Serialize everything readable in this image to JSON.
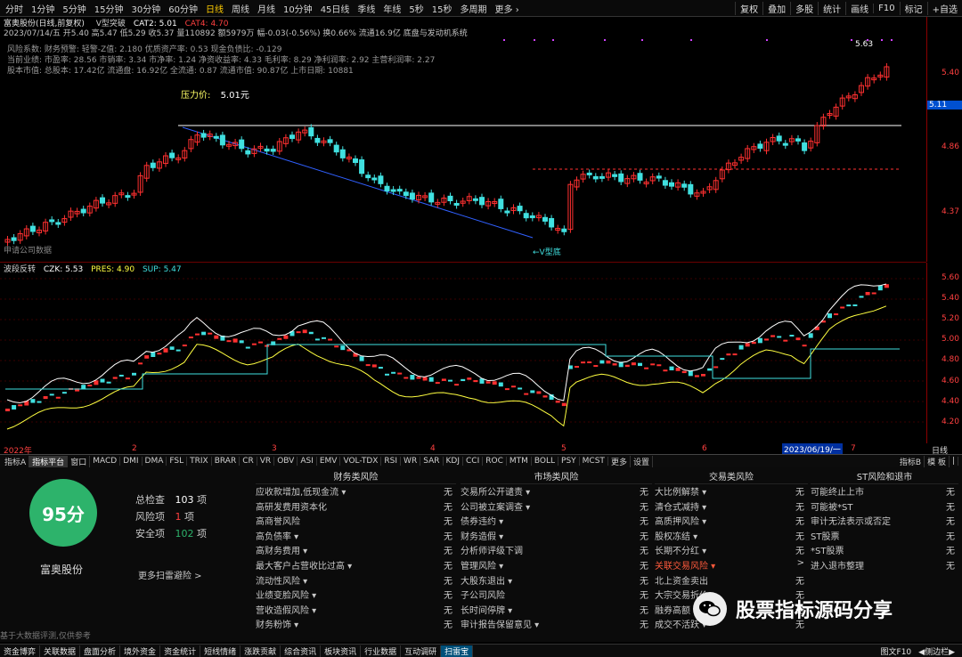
{
  "toolbar": {
    "timeframes": [
      "分时",
      "1分钟",
      "5分钟",
      "15分钟",
      "30分钟",
      "60分钟",
      "日线",
      "周线",
      "月线",
      "10分钟",
      "45日线",
      "季线",
      "年线",
      "5秒",
      "15秒",
      "多周期",
      "更多 ›"
    ],
    "active_index": 6,
    "right_buttons": [
      "复权",
      "叠加",
      "多股",
      "统计",
      "画线",
      "F10",
      "标记",
      "+自选"
    ]
  },
  "main_panel": {
    "title": "富奥股份(日线,前复权)",
    "indicator_name": "V型突破",
    "cat2_label": "CAT2: 5.01",
    "cat4_label": "CAT4: 4.70",
    "quote_line": "2023/07/14/五 开5.40 高5.47 低5.29 收5.37 量110892 额5979万 幅-0.03(-0.56%) 换0.66% 流通16.9亿 底盘与发动机系统",
    "info_line1": "风险系数: 财务预警: 轻警-Z值: 2.180 优质资产率: 0.53 现金负债比: -0.129",
    "info_line2": "当前业绩: 市盈率: 28.56 市销率: 3.34 市净率: 1.24 净资收益率: 4.33 毛利率: 8.29 净利润率: 2.92 主营利润率: 2.27",
    "info_line3": "股本市值: 总股本: 17.42亿 流通盘: 16.92亿 全流通: 0.87 流通市值: 90.87亿 上市日期: 10881",
    "pressure_label": "压力价:",
    "pressure_value": "5.01元",
    "peak_label": "5.63",
    "v_label": "←V型底",
    "bottom_left": "申请公司数据",
    "price_axis": [
      "5.40",
      "4.86",
      "4.37"
    ],
    "highlight_price": "5.11"
  },
  "sub_panel": {
    "title": "波段反转",
    "czk_label": "CZK: 5.53",
    "pres_label": "PRES: 4.90",
    "sup_label": "SUP: 5.47",
    "price_axis": [
      "5.60",
      "5.40",
      "5.20",
      "5.00",
      "4.80",
      "4.60",
      "4.40",
      "4.20"
    ],
    "date_labels": [
      "2022年",
      "2",
      "3",
      "4",
      "5",
      "6",
      "7"
    ],
    "date_selected": "2023/06/19/一",
    "right_label": "日线"
  },
  "tabs": {
    "items": [
      "指标A",
      "指标平台",
      "窗口",
      "MACD",
      "DMI",
      "DMA",
      "FSL",
      "TRIX",
      "BRAR",
      "CR",
      "VR",
      "OBV",
      "ASI",
      "EMV",
      "VOL-TDX",
      "RSI",
      "WR",
      "SAR",
      "KDJ",
      "CCI",
      "ROC",
      "MTM",
      "BOLL",
      "PSY",
      "MCST",
      "更多",
      "设置"
    ],
    "active_index": 1,
    "right_items": [
      "指标B",
      "模 板",
      "|"
    ]
  },
  "risk": {
    "score": "95分",
    "total_label": "总检查",
    "total_value": "103",
    "risk_label": "风险项",
    "risk_value": "1",
    "safe_label": "安全项",
    "safe_value": "102",
    "unit": "项",
    "stock_name": "富奥股份",
    "more_link": "更多扫雷避险 >",
    "disclaimer": "基于大数据评测,仅供参考",
    "columns": [
      {
        "title": "财务类风险",
        "rows": [
          [
            "应收款增加,低现金流 ▾",
            "无"
          ],
          [
            "高研发费用资本化",
            "无"
          ],
          [
            "高商誉风险",
            "无"
          ],
          [
            "高负债率 ▾",
            "无"
          ],
          [
            "高财务费用 ▾",
            "无"
          ],
          [
            "最大客户占营收比过高 ▾",
            "无"
          ],
          [
            "流动性风险 ▾",
            "无"
          ],
          [
            "业绩变脸风险 ▾",
            "无"
          ],
          [
            "营收造假风险 ▾",
            "无"
          ],
          [
            "财务粉饰 ▾",
            "无"
          ]
        ]
      },
      {
        "title": "市场类风险",
        "rows": [
          [
            "交易所公开谴责 ▾",
            "无"
          ],
          [
            "公司被立案调查 ▾",
            "无"
          ],
          [
            "债券违约 ▾",
            "无"
          ],
          [
            "财务造假 ▾",
            "无"
          ],
          [
            "分析师评级下调",
            "无"
          ],
          [
            "管理风险 ▾",
            "无"
          ],
          [
            "大股东退出 ▾",
            "无"
          ],
          [
            "子公司风险",
            "无"
          ],
          [
            "长时间停牌 ▾",
            "无"
          ],
          [
            "审计报告保留意见 ▾",
            "无"
          ]
        ]
      },
      {
        "title": "交易类风险",
        "rows": [
          [
            "大比例解禁 ▾",
            "无"
          ],
          [
            "清仓式减持 ▾",
            "无"
          ],
          [
            "高质押风险 ▾",
            "无"
          ],
          [
            "股权冻结 ▾",
            "无"
          ],
          [
            "长期不分红 ▾",
            "无"
          ],
          [
            "关联交易风险 ▾",
            ">"
          ],
          [
            "北上资金卖出",
            "无"
          ],
          [
            "大宗交易折价",
            "无"
          ],
          [
            "融券高额 ▾",
            "无"
          ],
          [
            "成交不活跃 ▾",
            "无"
          ]
        ]
      },
      {
        "title": "ST风险和退市",
        "rows": [
          [
            "可能终止上市",
            "无"
          ],
          [
            "可能被*ST",
            "无"
          ],
          [
            "审计无法表示或否定",
            "无"
          ],
          [
            "ST股票",
            "无"
          ],
          [
            "*ST股票",
            "无"
          ],
          [
            "进入退市整理",
            "无"
          ]
        ]
      }
    ],
    "highlight_row": "关联交易风险 ▾"
  },
  "watermark": {
    "text": "股票指标源码分享",
    "icon": "wechat-icon"
  },
  "bottom": {
    "items": [
      "资金博弈",
      "关联数据",
      "盘面分析",
      "境外资金",
      "资金统计",
      "短线情绪",
      "涨跌贡献",
      "综合资讯",
      "板块资讯",
      "行业数据",
      "互动调研",
      "扫雷宝"
    ],
    "active_index": 11,
    "right": "图文F10 ",
    "right_extra": "◀侧边栏▶"
  },
  "colors": {
    "up": "#ff3030",
    "down": "#40e0e0",
    "accent": "#ffcc00",
    "score": "#2db36b",
    "purple": "#d040ff"
  }
}
